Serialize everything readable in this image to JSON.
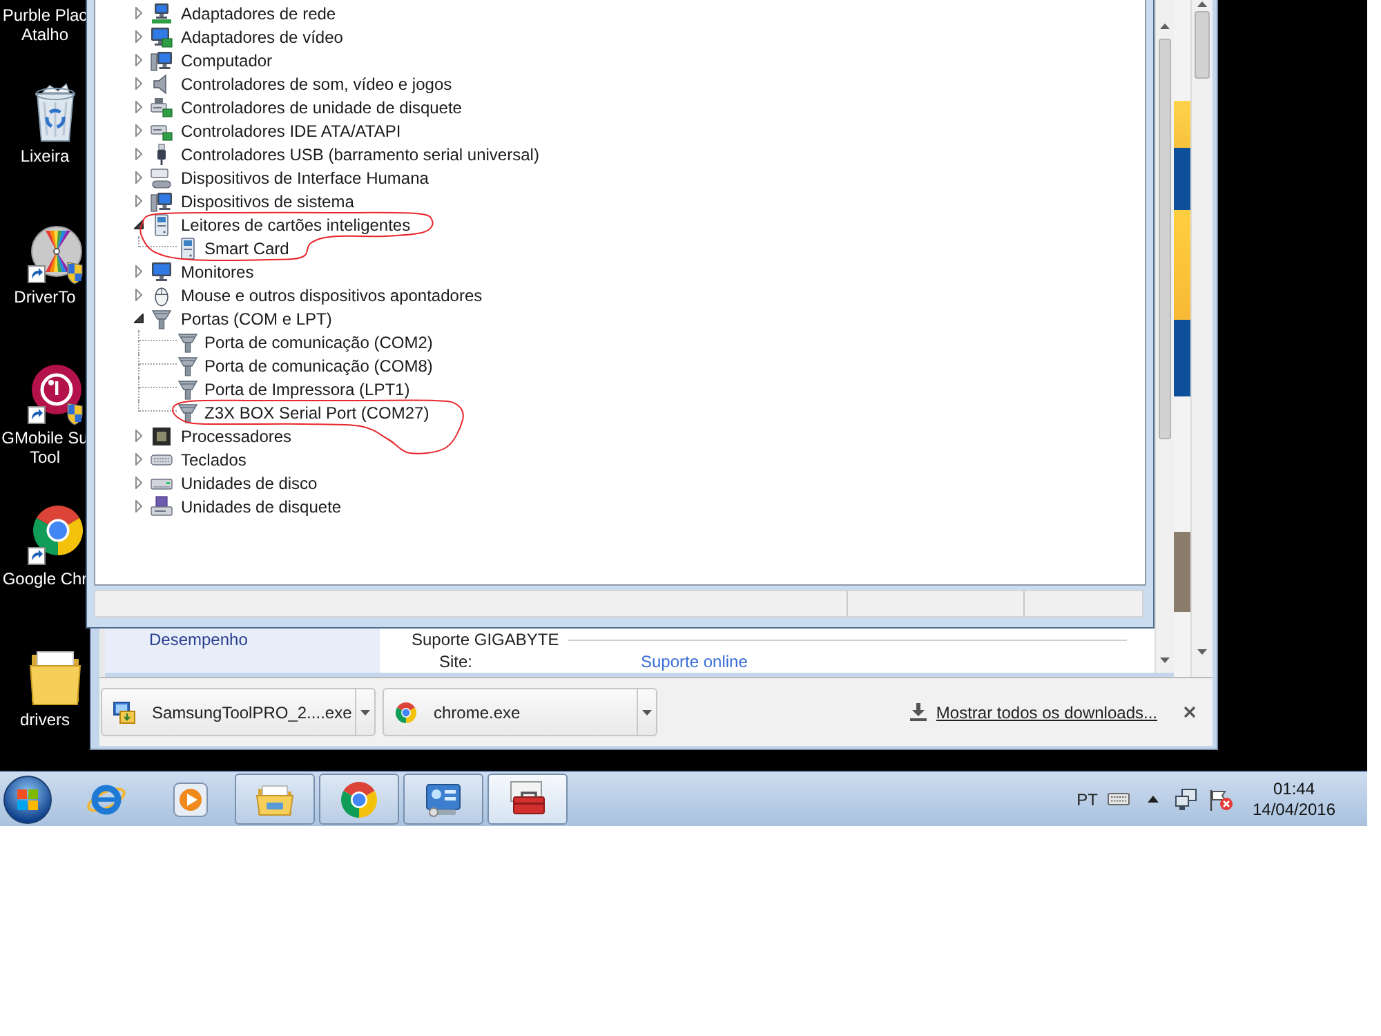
{
  "desktop": {
    "icons": [
      {
        "kind": "shortcut",
        "label": [
          "Purble Plac",
          "Atalho"
        ]
      },
      {
        "kind": "recycle",
        "label": [
          "Lixeira"
        ]
      },
      {
        "kind": "drivertool",
        "label": [
          "DriverTo"
        ]
      },
      {
        "kind": "lg",
        "label": [
          "GMobile Su",
          "Tool"
        ]
      },
      {
        "kind": "chrome",
        "label": [
          "Google Chr"
        ]
      },
      {
        "kind": "folder",
        "label": [
          "drivers"
        ]
      }
    ]
  },
  "device_manager": {
    "tree": [
      {
        "label": "Adaptadores de rede",
        "kind": "network",
        "expanded": false
      },
      {
        "label": "Adaptadores de vídeo",
        "kind": "display",
        "expanded": false
      },
      {
        "label": "Computador",
        "kind": "computer",
        "expanded": false
      },
      {
        "label": "Controladores de som, vídeo e jogos",
        "kind": "sound",
        "expanded": false
      },
      {
        "label": "Controladores de unidade de disquete",
        "kind": "floppyctl",
        "expanded": false
      },
      {
        "label": "Controladores IDE ATA/ATAPI",
        "kind": "ide",
        "expanded": false
      },
      {
        "label": "Controladores USB (barramento serial universal)",
        "kind": "usb",
        "expanded": false
      },
      {
        "label": "Dispositivos de Interface Humana",
        "kind": "hid",
        "expanded": false
      },
      {
        "label": "Dispositivos de sistema",
        "kind": "system",
        "expanded": false
      },
      {
        "label": "Leitores de cartões inteligentes",
        "kind": "smartcard",
        "expanded": true,
        "children": [
          {
            "label": "Smart Card",
            "kind": "smartcard"
          }
        ]
      },
      {
        "label": "Monitores",
        "kind": "monitor",
        "expanded": false
      },
      {
        "label": "Mouse e outros dispositivos apontadores",
        "kind": "mouse",
        "expanded": false
      },
      {
        "label": "Portas (COM e LPT)",
        "kind": "port",
        "expanded": true,
        "children": [
          {
            "label": "Porta de comunicação (COM2)",
            "kind": "port"
          },
          {
            "label": "Porta de comunicação (COM8)",
            "kind": "port"
          },
          {
            "label": "Porta de Impressora (LPT1)",
            "kind": "port"
          },
          {
            "label": "Z3X BOX Serial Port (COM27)",
            "kind": "port"
          }
        ]
      },
      {
        "label": "Processadores",
        "kind": "processor",
        "expanded": false
      },
      {
        "label": "Teclados",
        "kind": "keyboard",
        "expanded": false
      },
      {
        "label": "Unidades de disco",
        "kind": "disk",
        "expanded": false
      },
      {
        "label": "Unidades de disquete",
        "kind": "floppy",
        "expanded": false
      }
    ]
  },
  "browser": {
    "page": {
      "sidebar_item": "Desempenho",
      "section_title": "Suporte GIGABYTE",
      "fields": [
        {
          "label": "Site:",
          "link": "Suporte online"
        }
      ]
    },
    "download_bar": {
      "items": [
        {
          "kind": "installer",
          "name": "SamsungToolPRO_2....exe"
        },
        {
          "kind": "chrome",
          "name": "chrome.exe"
        }
      ],
      "show_all": "Mostrar todos os downloads..."
    }
  },
  "taskbar": {
    "buttons": [
      {
        "kind": "ie",
        "running": false,
        "active": false
      },
      {
        "kind": "media",
        "running": false,
        "active": false
      },
      {
        "kind": "explorer",
        "running": true,
        "active": false
      },
      {
        "kind": "chrome",
        "running": true,
        "active": false
      },
      {
        "kind": "controlpanel",
        "running": true,
        "active": false
      },
      {
        "kind": "toolbox",
        "running": true,
        "active": true
      }
    ],
    "tray": {
      "language": "PT",
      "time": "01:44",
      "date": "14/04/2016"
    }
  }
}
